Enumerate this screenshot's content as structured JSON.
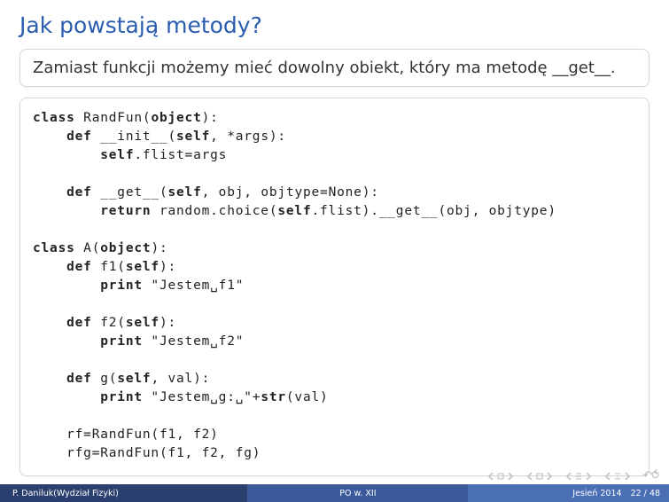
{
  "title": "Jak powstają metody?",
  "callout": "Zamiast funkcji możemy mieć dowolny obiekt, który ma metodę __get__.",
  "code": {
    "l1a": "class",
    "l1b": " RandFun(",
    "l1c": "object",
    "l1d": "):",
    "l2a": "    def",
    "l2b": " __init__(",
    "l2c": "self",
    "l2d": ", *args):",
    "l3a": "        self",
    "l3b": ".flist=args",
    "l4": "",
    "l5a": "    def",
    "l5b": " __get__(",
    "l5c": "self",
    "l5d": ", obj, objtype=None):",
    "l6a": "        return",
    "l6b": " random.choice(",
    "l6c": "self",
    "l6d": ".flist).__get__(obj, objtype)",
    "l7": "",
    "l8a": "class",
    "l8b": " A(",
    "l8c": "object",
    "l8d": "):",
    "l9a": "    def",
    "l9b": " f1(",
    "l9c": "self",
    "l9d": "):",
    "l10a": "        print",
    "l10b": " \"Jestem␣f1\"",
    "l11": "",
    "l12a": "    def",
    "l12b": " f2(",
    "l12c": "self",
    "l12d": "):",
    "l13a": "        print",
    "l13b": " \"Jestem␣f2\"",
    "l14": "",
    "l15a": "    def",
    "l15b": " g(",
    "l15c": "self",
    "l15d": ", val):",
    "l16a": "        print",
    "l16b": " \"Jestem␣g:␣\"+",
    "l16c": "str",
    "l16d": "(val)",
    "l17": "",
    "l18": "    rf=RandFun(f1, f2)",
    "l19": "    rfg=RandFun(f1, f2, fg)"
  },
  "footer": {
    "author": "P. Daniluk(Wydział Fizyki)",
    "center": "PO w. XII",
    "term": "Jesień 2014",
    "page": "22 / 48"
  }
}
